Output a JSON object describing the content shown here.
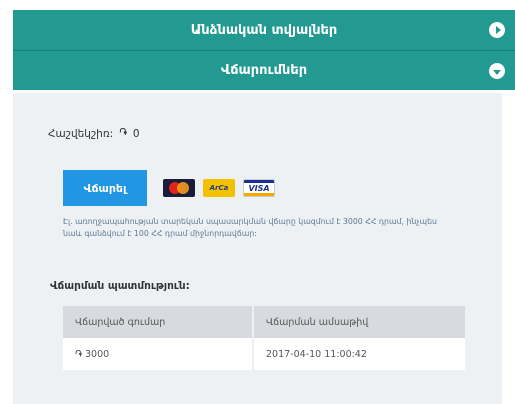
{
  "accordion": {
    "personal_data": "Անձնական տվյալներ",
    "payments": "Վճարումներ"
  },
  "balance": {
    "label": "Հաշվեկշիռ:",
    "currency": "֏",
    "amount": "0"
  },
  "pay_button": "Վճարել",
  "cards": {
    "arca": "ArCa",
    "visa": "VISA"
  },
  "note": "Էլ. առողջապահության տարեկան սպասարկման վճարը կազմում է 3000 ՀՀ դրամ, ինչպես նաև գանձվում է 100 ՀՀ դրամ միջնորդավճար:",
  "history": {
    "title": "Վճարման պատմություն:",
    "columns": [
      "Վճարված գումար",
      "Վճարման ամսաթիվ"
    ],
    "rows": [
      {
        "currency": "֏",
        "amount": "3000",
        "date": "2017-04-10 11:00:42"
      }
    ]
  },
  "colors": {
    "accent": "#229a91",
    "button": "#2196e3",
    "panel": "#eef1f3"
  }
}
